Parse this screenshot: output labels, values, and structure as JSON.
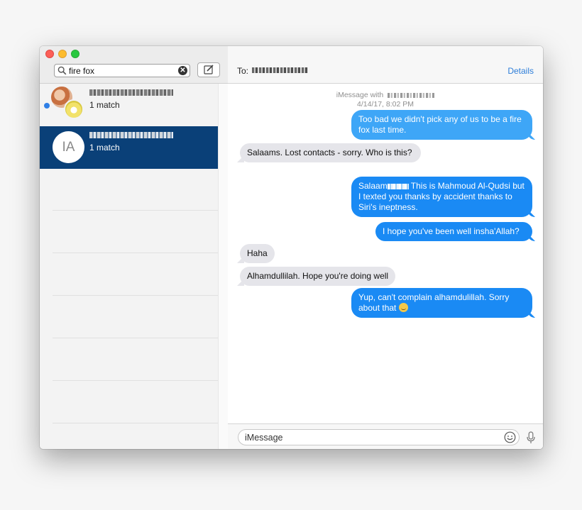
{
  "window": {
    "controls": [
      "close",
      "minimize",
      "maximize"
    ]
  },
  "sidebar": {
    "search": {
      "value": "fire fox",
      "icon": "search-icon",
      "clear_icon": "clear-icon"
    },
    "compose_icon": "compose-icon",
    "conversations": [
      {
        "match": "1 match",
        "unread": true,
        "avatar": "group-avatar"
      },
      {
        "initials": "IA",
        "match": "1 match",
        "selected": true
      }
    ]
  },
  "chat": {
    "to_label": "To:",
    "details_label": "Details",
    "service_label": "iMessage with",
    "timestamp": "4/14/17, 8:02 PM",
    "messages": [
      {
        "direction": "out",
        "text": "Too bad we didn't pick any of us to be a fire fox last time."
      },
      {
        "direction": "in",
        "text": "Salaams. Lost contacts - sorry. Who is this?"
      },
      {
        "direction": "out",
        "text_before": "Salaam",
        "text_after": "  This is Mahmoud Al-Qudsi but I texted you thanks by accident thanks to Siri's ineptness."
      },
      {
        "direction": "out",
        "text": "I hope you've been well insha'Allah?"
      },
      {
        "direction": "in",
        "text": "Haha"
      },
      {
        "direction": "in",
        "text": "Alhamdullilah. Hope you're doing well"
      },
      {
        "direction": "out",
        "text": "Yup, can't complain alhamdulillah. Sorry about that",
        "emoji": "relieved-face"
      }
    ],
    "input": {
      "placeholder": "iMessage",
      "emoji_icon": "emoji-icon",
      "mic_icon": "microphone-icon"
    }
  },
  "colors": {
    "selection": "#0a4078",
    "bubble_out": "#1a8af4",
    "bubble_in": "#e5e5ea",
    "link": "#2e7ed9"
  }
}
